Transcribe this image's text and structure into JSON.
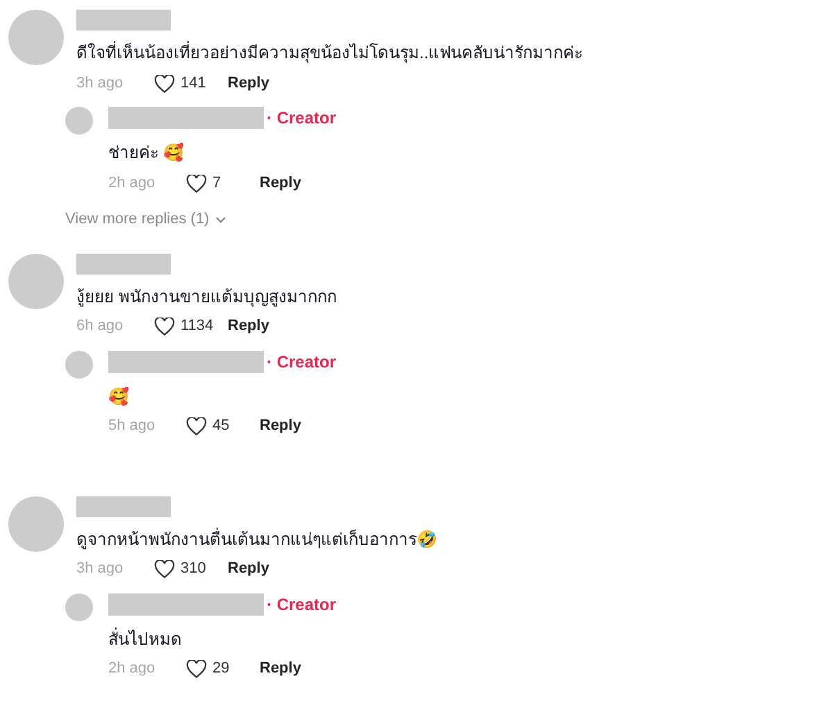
{
  "comments": [
    {
      "text": "ดีใจที่เห็นน้องเที่ยวอย่างมีความสุขน้องไม่โดนรุม..แฟนคลับน่ารักมากค่ะ",
      "time": "3h ago",
      "likes": "141",
      "reply_label": "Reply",
      "replies": [
        {
          "badge": "· Creator",
          "text": "ช่ายค่ะ 🥰",
          "time": "2h ago",
          "likes": "7",
          "reply_label": "Reply"
        }
      ],
      "more_replies": "View more replies (1)"
    },
    {
      "text": "งู้ยยย พนักงานขายแต้มบุญสูงมากกก",
      "time": "6h ago",
      "likes": "1134",
      "reply_label": "Reply",
      "replies": [
        {
          "badge": "· Creator",
          "text": "🥰",
          "time": "5h ago",
          "likes": "45",
          "reply_label": "Reply"
        }
      ]
    },
    {
      "text": "ดูจากหน้าพนักงานตื่นเต้นมากแน่ๆแต่เก็บอาการ🤣",
      "time": "3h ago",
      "likes": "310",
      "reply_label": "Reply",
      "replies": [
        {
          "badge": "· Creator",
          "text": "สั่นไปหมด",
          "time": "2h ago",
          "likes": "29",
          "reply_label": "Reply"
        }
      ]
    }
  ]
}
